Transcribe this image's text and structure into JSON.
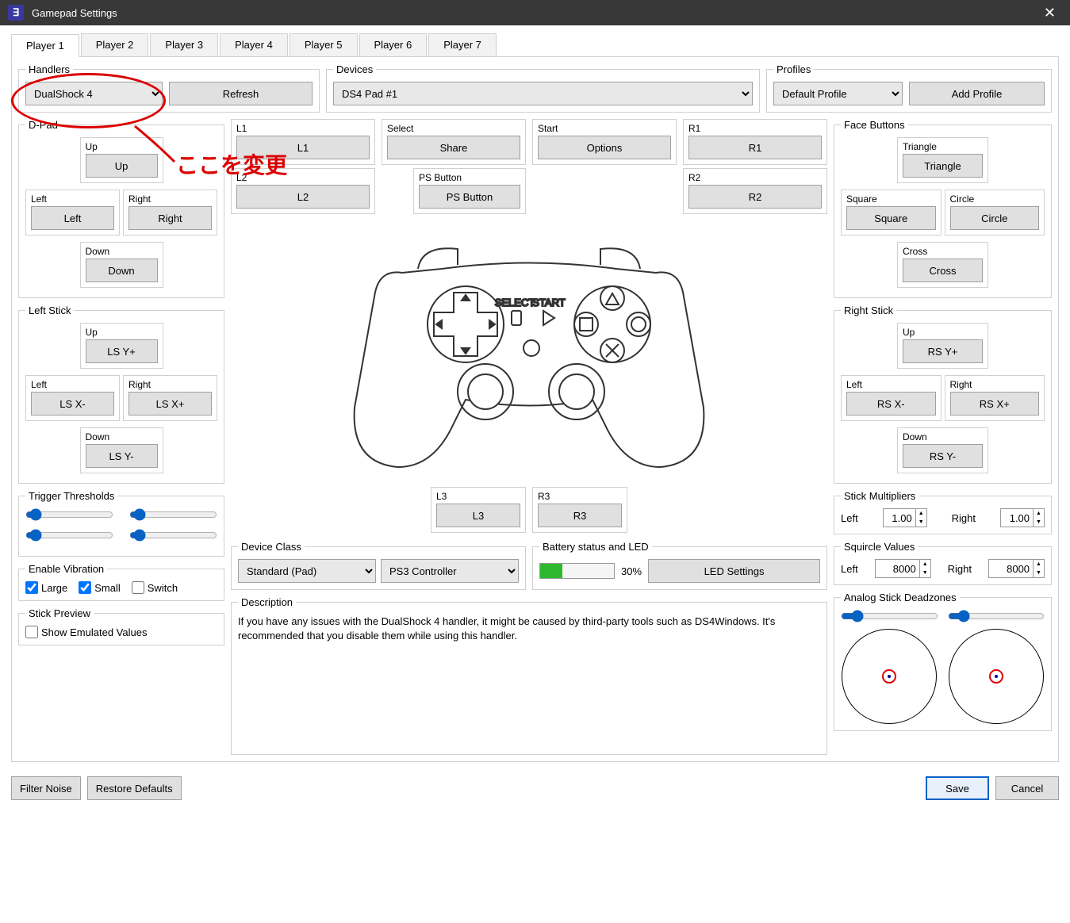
{
  "window": {
    "title": "Gamepad Settings"
  },
  "tabs": [
    "Player 1",
    "Player 2",
    "Player 3",
    "Player 4",
    "Player 5",
    "Player 6",
    "Player 7"
  ],
  "handlers": {
    "legend": "Handlers",
    "value": "DualShock 4",
    "refresh": "Refresh"
  },
  "devices": {
    "legend": "Devices",
    "value": "DS4 Pad #1"
  },
  "profiles": {
    "legend": "Profiles",
    "value": "Default Profile",
    "add": "Add Profile"
  },
  "dpad": {
    "legend": "D-Pad",
    "up_lbl": "Up",
    "up": "Up",
    "left_lbl": "Left",
    "left": "Left",
    "right_lbl": "Right",
    "right": "Right",
    "down_lbl": "Down",
    "down": "Down"
  },
  "leftstick": {
    "legend": "Left Stick",
    "up_lbl": "Up",
    "up": "LS Y+",
    "left_lbl": "Left",
    "left": "LS X-",
    "right_lbl": "Right",
    "right": "LS X+",
    "down_lbl": "Down",
    "down": "LS Y-"
  },
  "l1": {
    "legend": "L1",
    "val": "L1"
  },
  "l2": {
    "legend": "L2",
    "val": "L2"
  },
  "select": {
    "legend": "Select",
    "val": "Share"
  },
  "start": {
    "legend": "Start",
    "val": "Options"
  },
  "psbutton": {
    "legend": "PS Button",
    "val": "PS Button"
  },
  "r1": {
    "legend": "R1",
    "val": "R1"
  },
  "r2": {
    "legend": "R2",
    "val": "R2"
  },
  "l3": {
    "legend": "L3",
    "val": "L3"
  },
  "r3": {
    "legend": "R3",
    "val": "R3"
  },
  "face": {
    "legend": "Face Buttons",
    "tri_lbl": "Triangle",
    "tri": "Triangle",
    "sq_lbl": "Square",
    "sq": "Square",
    "ci_lbl": "Circle",
    "ci": "Circle",
    "cr_lbl": "Cross",
    "cr": "Cross"
  },
  "rightstick": {
    "legend": "Right Stick",
    "up_lbl": "Up",
    "up": "RS Y+",
    "left_lbl": "Left",
    "left": "RS X-",
    "right_lbl": "Right",
    "right": "RS X+",
    "down_lbl": "Down",
    "down": "RS Y-"
  },
  "triggers": {
    "legend": "Trigger Thresholds"
  },
  "vibration": {
    "legend": "Enable Vibration",
    "large": "Large",
    "small": "Small",
    "switch": "Switch"
  },
  "stickpreview": {
    "legend": "Stick Preview",
    "show": "Show Emulated Values"
  },
  "deviceclass": {
    "legend": "Device Class",
    "v1": "Standard (Pad)",
    "v2": "PS3 Controller"
  },
  "battery": {
    "legend": "Battery status and LED",
    "pct": "30%",
    "led": "LED Settings"
  },
  "description": {
    "legend": "Description",
    "text": "If you have any issues with the DualShock 4 handler, it might be caused by third-party tools such as DS4Windows. It's recommended that you disable them while using this handler."
  },
  "stickmult": {
    "legend": "Stick Multipliers",
    "left_lbl": "Left",
    "left": "1.00",
    "right_lbl": "Right",
    "right": "1.00"
  },
  "squircle": {
    "legend": "Squircle Values",
    "left_lbl": "Left",
    "left": "8000",
    "right_lbl": "Right",
    "right": "8000"
  },
  "deadzones": {
    "legend": "Analog Stick Deadzones"
  },
  "footer": {
    "filter": "Filter Noise",
    "restore": "Restore Defaults",
    "save": "Save",
    "cancel": "Cancel"
  },
  "annotation": "ここを変更",
  "controller_labels": {
    "select": "SELECT",
    "start": "START"
  }
}
